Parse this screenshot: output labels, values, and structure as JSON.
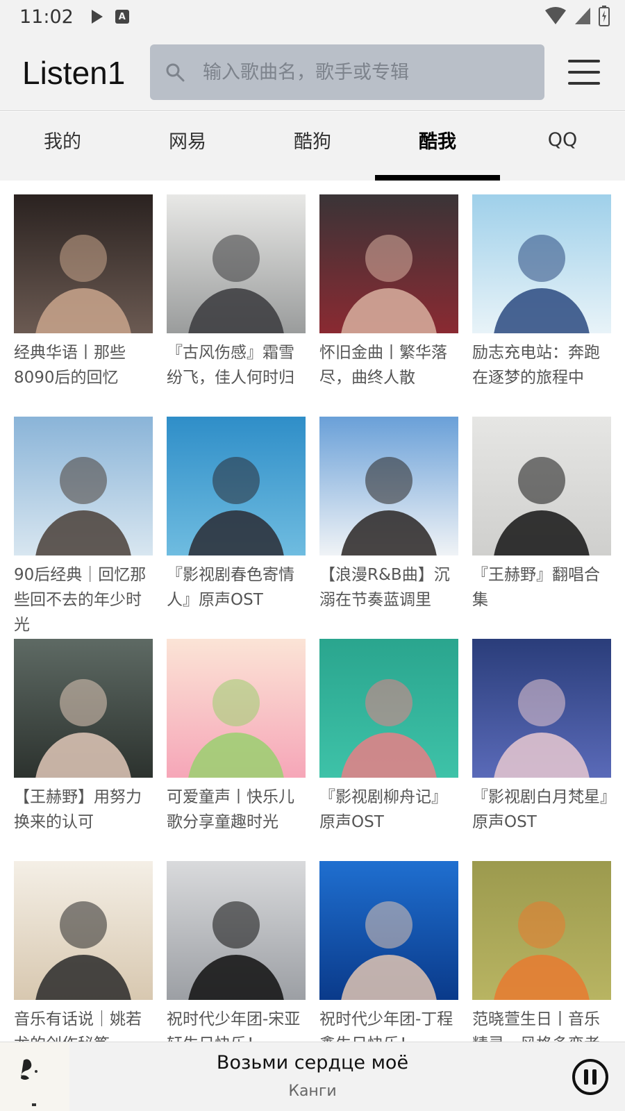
{
  "status_bar": {
    "time": "11:02"
  },
  "header": {
    "title": "Listen1",
    "search_placeholder": "输入歌曲名，歌手或专辑"
  },
  "tabs": [
    {
      "label": "我的",
      "active": false
    },
    {
      "label": "网易",
      "active": false
    },
    {
      "label": "酷狗",
      "active": false
    },
    {
      "label": "酷我",
      "active": true
    },
    {
      "label": "QQ",
      "active": false
    }
  ],
  "playlists": [
    {
      "title": "经典华语丨那些8090后的回忆",
      "palette": [
        "#2a2220",
        "#6b5a52",
        "#c9a58c"
      ]
    },
    {
      "title": "『古风伤感』霜雪纷飞，佳人何时归",
      "palette": [
        "#e8e8e6",
        "#9a9c9c",
        "#3a3a3d"
      ]
    },
    {
      "title": "怀旧金曲丨繁华落尽，曲终人散",
      "palette": [
        "#3a3437",
        "#8a2a32",
        "#d8b0a0"
      ]
    },
    {
      "title": "励志充电站：奔跑在逐梦的旅程中",
      "palette": [
        "#9fd0ea",
        "#e8f3f8",
        "#2c4a80"
      ]
    },
    {
      "title": "90后经典｜回忆那些回不去的年少时光",
      "palette": [
        "#8ab4d8",
        "#d8e6f0",
        "#4a4038"
      ]
    },
    {
      "title": "『影视剧春色寄情人』原声OST",
      "palette": [
        "#2f8ec8",
        "#6fbce0",
        "#2a2b34"
      ]
    },
    {
      "title": "【浪漫R&B曲】沉溺在节奏蓝调里",
      "palette": [
        "#6aa0d8",
        "#f0f3f6",
        "#2a2624"
      ]
    },
    {
      "title": "『王赫野』翻唱合集",
      "palette": [
        "#e6e6e4",
        "#cfcfcd",
        "#151515"
      ]
    },
    {
      "title": "【王赫野】用努力换来的认可",
      "palette": [
        "#5e6a64",
        "#2c322e",
        "#e0c8b8"
      ]
    },
    {
      "title": "可爱童声丨快乐儿歌分享童趣时光",
      "palette": [
        "#fbe4d6",
        "#f6a6b8",
        "#9ad070"
      ]
    },
    {
      "title": "『影视剧柳舟记』原声OST",
      "palette": [
        "#2aa58e",
        "#3ec2a8",
        "#e87f86"
      ]
    },
    {
      "title": "『影视剧白月梵星』原声OST",
      "palette": [
        "#2a3d7a",
        "#5a6ab8",
        "#e8c8d0"
      ]
    },
    {
      "title": "音乐有话说｜姚若龙的创作秘笈",
      "palette": [
        "#f4efe6",
        "#d8c8b0",
        "#2a2a2a"
      ]
    },
    {
      "title": "祝时代少年团-宋亚轩生日快乐！",
      "palette": [
        "#d9dadc",
        "#9c9fa4",
        "#111111"
      ]
    },
    {
      "title": "祝时代少年团-丁程鑫生日快乐！",
      "palette": [
        "#1f6fd0",
        "#0a3a8a",
        "#e0c4b2"
      ]
    },
    {
      "title": "范晓萱生日丨音乐精灵，风格多变者",
      "palette": [
        "#9c9a4e",
        "#b8b462",
        "#e87a30"
      ]
    }
  ],
  "player": {
    "song": "Возьми сердце моё",
    "artist": "Канги"
  }
}
